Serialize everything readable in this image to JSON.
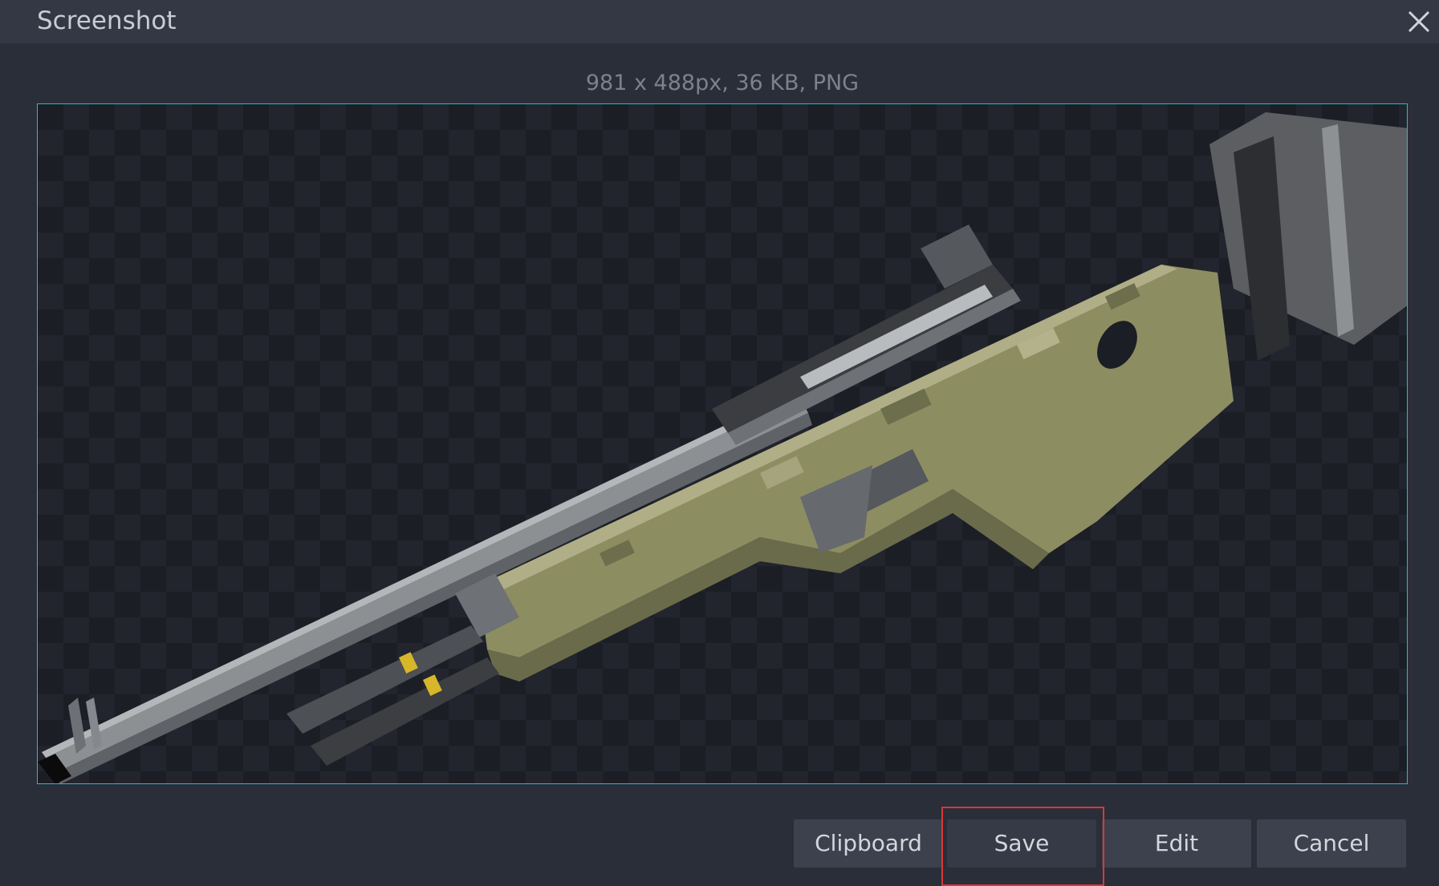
{
  "dialog": {
    "title": "Screenshot",
    "close_icon": "close-icon"
  },
  "image_info": "981 x 488px, 36 KB, PNG",
  "buttons": {
    "clipboard": "Clipboard",
    "save": "Save",
    "edit": "Edit",
    "cancel": "Cancel"
  },
  "colors": {
    "accent_border": "#2fb8c2",
    "highlight": "#d6393a"
  }
}
